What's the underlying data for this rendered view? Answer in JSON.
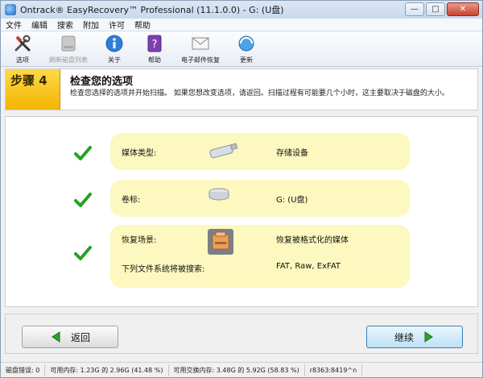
{
  "window": {
    "title": "Ontrack® EasyRecovery™ Professional (11.1.0.0) - G: (U盘)",
    "controls": {
      "minimize": "—",
      "maximize": "□",
      "close": "✕"
    }
  },
  "menu": {
    "items": [
      "文件",
      "编辑",
      "搜索",
      "附加",
      "许可",
      "帮助"
    ]
  },
  "toolbar": {
    "options": "选项",
    "refresh": "刷新磁盘列表",
    "about": "关于",
    "help": "帮助",
    "email_recovery": "电子邮件恢复",
    "update": "更新"
  },
  "step": {
    "label": "步骤 4",
    "title": "检查您的选项",
    "description": "检查您选择的选项并开始扫描。 如果您想改变选项，请返回。扫描过程有可能要几个小时，这主要取决于磁盘的大小。"
  },
  "summary": {
    "media": {
      "label": "媒体类型:",
      "value": "存储设备"
    },
    "volume": {
      "label": "卷标:",
      "value": "G: (U盘)"
    },
    "scenario": {
      "label": "恢复场景:",
      "value": "恢复被格式化的媒体",
      "fs_label": "下列文件系统将被搜索:",
      "fs_value": "FAT, Raw, ExFAT"
    }
  },
  "buttons": {
    "back": "返回",
    "next": "继续"
  },
  "status": {
    "errors": "磁盘错误: 0",
    "memory": "可用内存: 1.23G 的 2.96G (41.48 %)",
    "swap": "可用交换内存: 3.48G 的 5.92G (58.83 %)",
    "build": "r8363:8419^n"
  },
  "colors": {
    "check": "#22a322",
    "panel": "#fdf8bf",
    "step_accent": "#f2b500"
  }
}
